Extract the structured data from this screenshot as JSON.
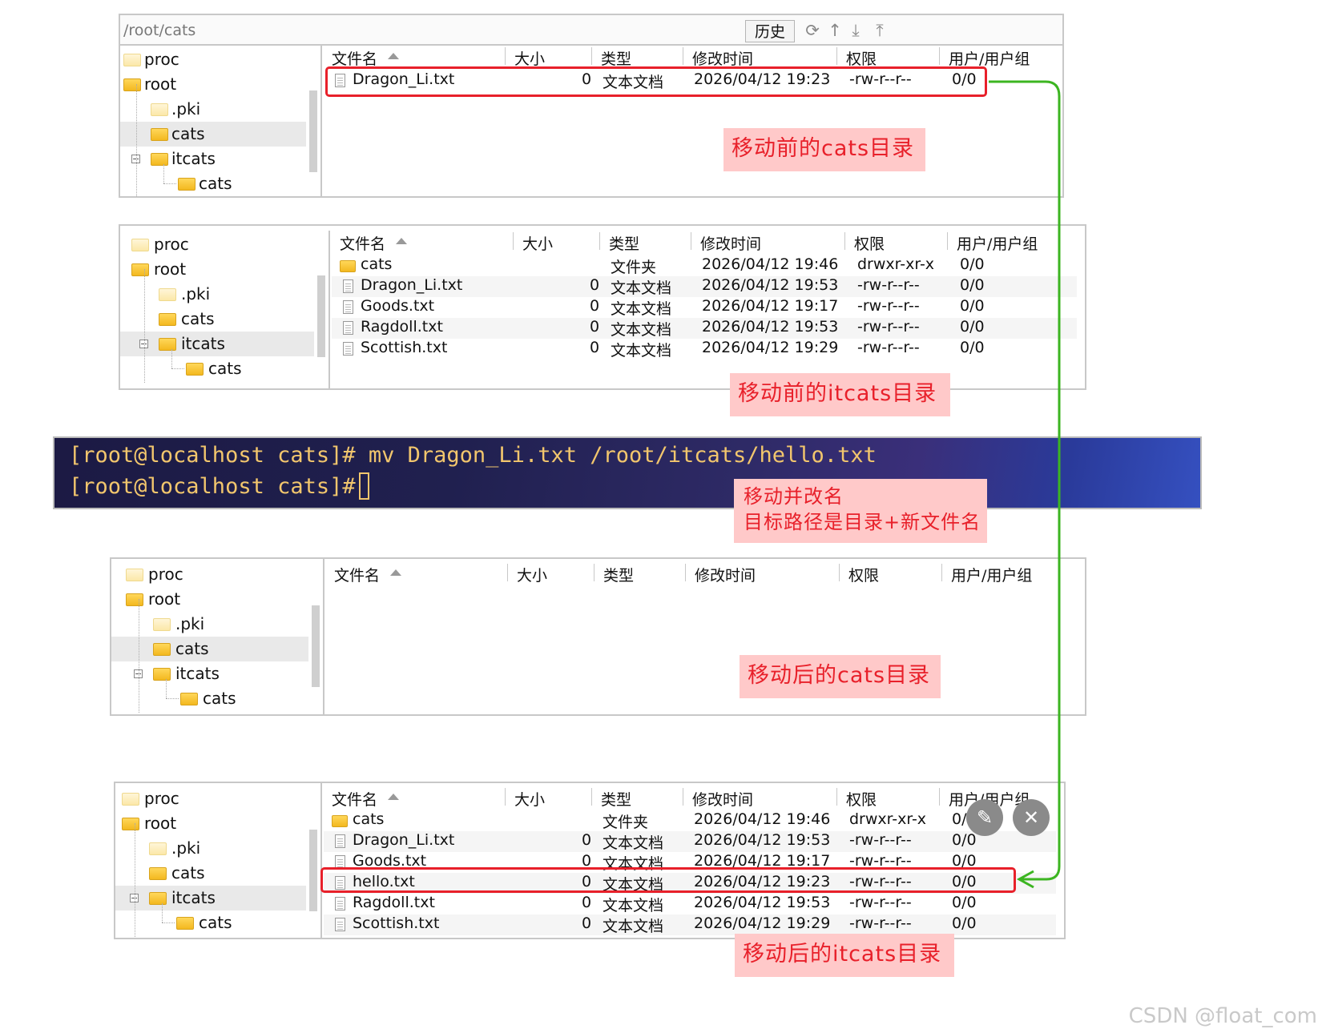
{
  "panel1": {
    "path": "/root/cats",
    "history_label": "历史",
    "tree": [
      "proc",
      "root",
      ".pki",
      "cats",
      "itcats",
      "cats"
    ],
    "headers": [
      "文件名",
      "大小",
      "类型",
      "修改时间",
      "权限",
      "用户/用户组"
    ],
    "rows": [
      {
        "name": "Dragon_Li.txt",
        "size": "0",
        "type": "文本文档",
        "mtime": "2026/04/12 19:23",
        "perm": "-rw-r--r--",
        "owner": "0/0"
      }
    ],
    "note": "移动前的cats目录"
  },
  "panel2": {
    "tree": [
      "proc",
      "root",
      ".pki",
      "cats",
      "itcats",
      "cats"
    ],
    "headers": [
      "文件名",
      "大小",
      "类型",
      "修改时间",
      "权限",
      "用户/用户组"
    ],
    "rows": [
      {
        "name": "cats",
        "size": "",
        "type": "文件夹",
        "mtime": "2026/04/12 19:46",
        "perm": "drwxr-xr-x",
        "owner": "0/0"
      },
      {
        "name": "Dragon_Li.txt",
        "size": "0",
        "type": "文本文档",
        "mtime": "2026/04/12 19:53",
        "perm": "-rw-r--r--",
        "owner": "0/0"
      },
      {
        "name": "Goods.txt",
        "size": "0",
        "type": "文本文档",
        "mtime": "2026/04/12 19:17",
        "perm": "-rw-r--r--",
        "owner": "0/0"
      },
      {
        "name": "Ragdoll.txt",
        "size": "0",
        "type": "文本文档",
        "mtime": "2026/04/12 19:53",
        "perm": "-rw-r--r--",
        "owner": "0/0"
      },
      {
        "name": "Scottish.txt",
        "size": "0",
        "type": "文本文档",
        "mtime": "2026/04/12 19:29",
        "perm": "-rw-r--r--",
        "owner": "0/0"
      }
    ],
    "note": "移动前的itcats目录"
  },
  "terminal": {
    "line1": "[root@localhost cats]# mv Dragon_Li.txt /root/itcats/hello.txt",
    "line2": "[root@localhost cats]# ",
    "note_line1": "移动并改名",
    "note_line2": "目标路径是目录+新文件名"
  },
  "panel3": {
    "tree": [
      "proc",
      "root",
      ".pki",
      "cats",
      "itcats",
      "cats"
    ],
    "headers": [
      "文件名",
      "大小",
      "类型",
      "修改时间",
      "权限",
      "用户/用户组"
    ],
    "note": "移动后的cats目录"
  },
  "panel4": {
    "tree": [
      "proc",
      "root",
      ".pki",
      "cats",
      "itcats",
      "cats"
    ],
    "headers": [
      "文件名",
      "大小",
      "类型",
      "修改时间",
      "权限",
      "用户/用户组"
    ],
    "rows": [
      {
        "name": "cats",
        "size": "",
        "type": "文件夹",
        "mtime": "2026/04/12 19:46",
        "perm": "drwxr-xr-x",
        "owner": "0/0"
      },
      {
        "name": "Dragon_Li.txt",
        "size": "0",
        "type": "文本文档",
        "mtime": "2026/04/12 19:53",
        "perm": "-rw-r--r--",
        "owner": "0/0"
      },
      {
        "name": "Goods.txt",
        "size": "0",
        "type": "文本文档",
        "mtime": "2026/04/12 19:17",
        "perm": "-rw-r--r--",
        "owner": "0/0"
      },
      {
        "name": "hello.txt",
        "size": "0",
        "type": "文本文档",
        "mtime": "2026/04/12 19:23",
        "perm": "-rw-r--r--",
        "owner": "0/0"
      },
      {
        "name": "Ragdoll.txt",
        "size": "0",
        "type": "文本文档",
        "mtime": "2026/04/12 19:53",
        "perm": "-rw-r--r--",
        "owner": "0/0"
      },
      {
        "name": "Scottish.txt",
        "size": "0",
        "type": "文本文档",
        "mtime": "2026/04/12 19:29",
        "perm": "-rw-r--r--",
        "owner": "0/0"
      }
    ],
    "note": "移动后的itcats目录"
  },
  "float_buttons": {
    "edit_icon": "✎",
    "close_icon": "✕"
  },
  "watermark": "CSDN @float_com",
  "colors": {
    "highlight_red": "#e8202a",
    "arrow_green": "#3cb521",
    "note_bg": "#ffc9c9",
    "terminal_text": "#f2c66d"
  }
}
